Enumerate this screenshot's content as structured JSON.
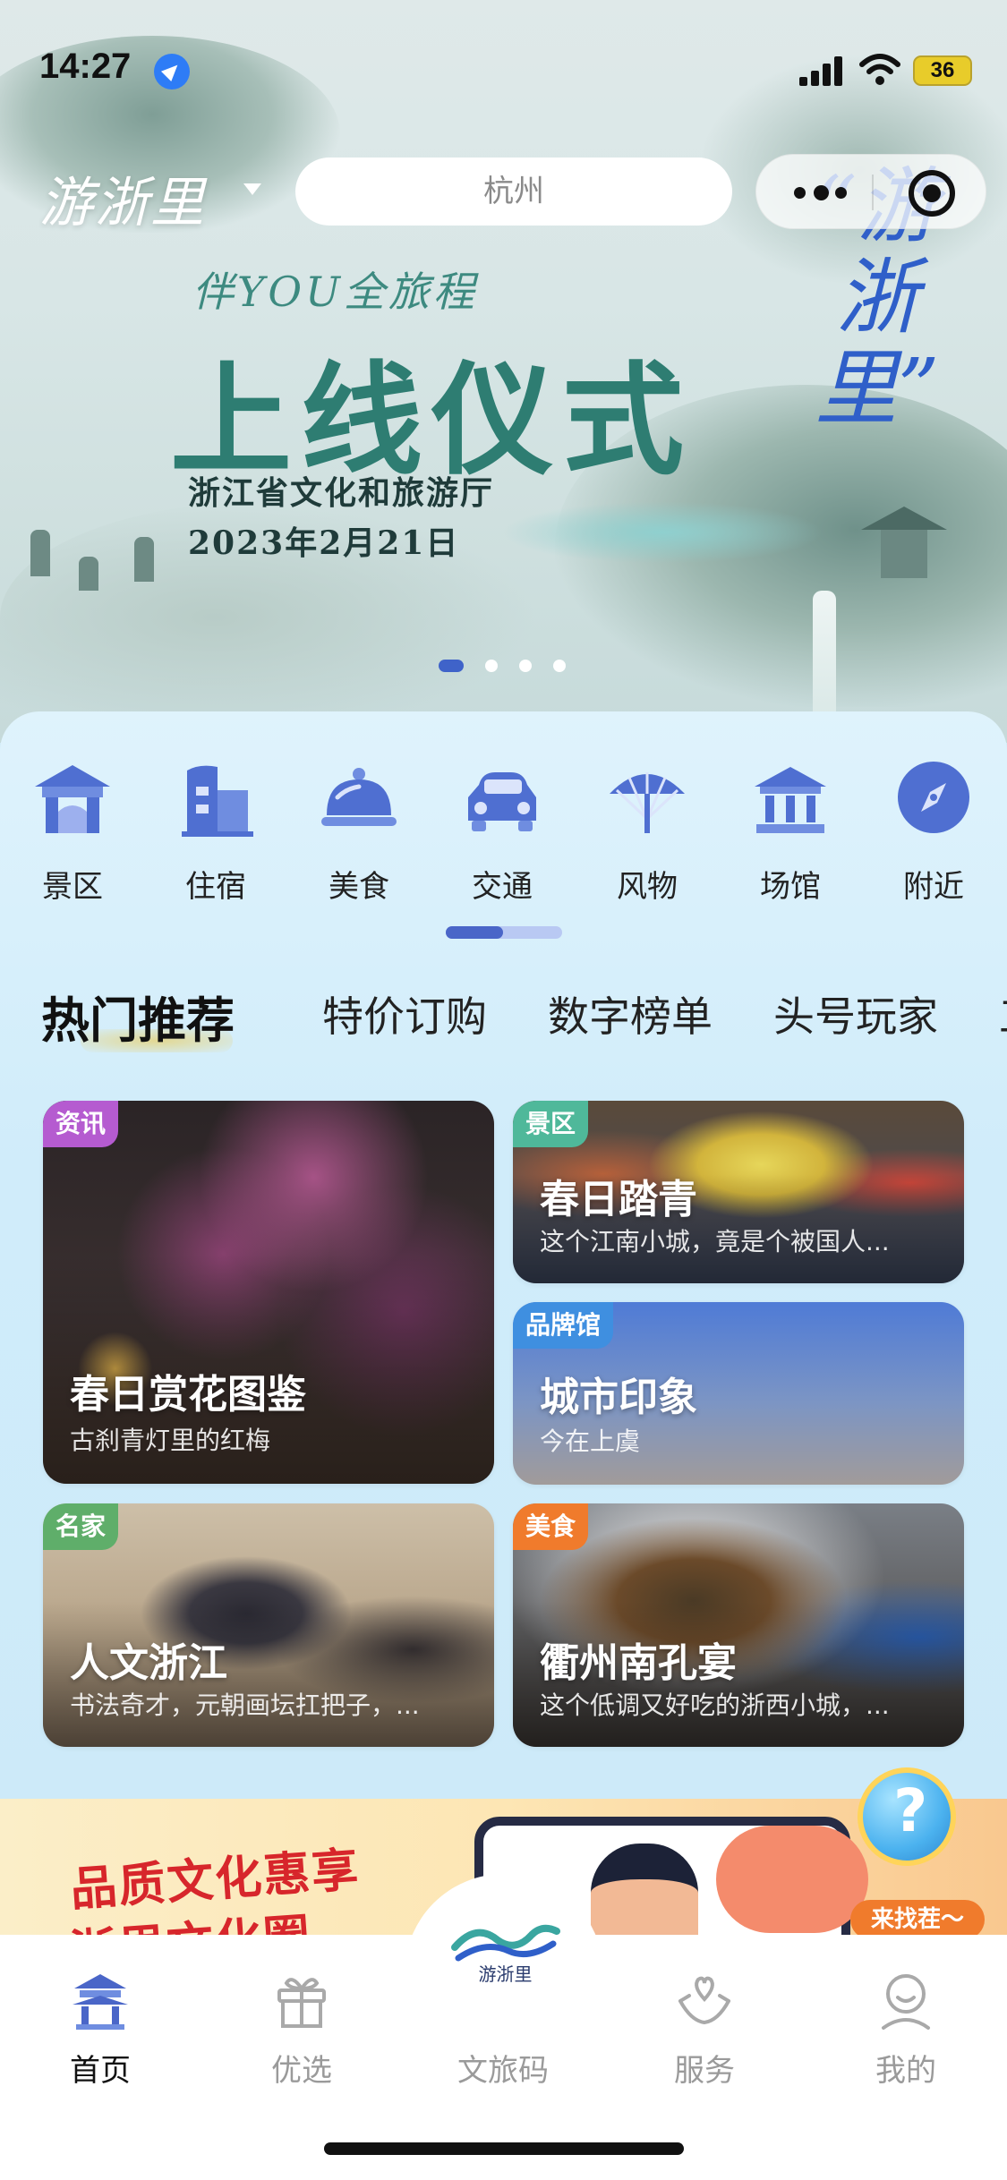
{
  "status_bar": {
    "time": "14:27",
    "battery": "36"
  },
  "header": {
    "brand": "游浙里",
    "search_value": "杭州"
  },
  "banner": {
    "slogan": "伴YOU全旅程",
    "title": "上线仪式",
    "org": "浙江省文化和旅游厅",
    "date": "2023年2月21日",
    "side_text": "“游浙里”",
    "dots": 4,
    "active_dot": 0
  },
  "categories": [
    {
      "label": "景区",
      "icon": "scenic-gate-icon"
    },
    {
      "label": "住宿",
      "icon": "hotel-building-icon"
    },
    {
      "label": "美食",
      "icon": "food-cloche-icon"
    },
    {
      "label": "交通",
      "icon": "car-icon"
    },
    {
      "label": "风物",
      "icon": "fan-icon"
    },
    {
      "label": "场馆",
      "icon": "museum-icon"
    },
    {
      "label": "附近",
      "icon": "compass-icon"
    }
  ],
  "tabs": [
    "热门推荐",
    "特价订购",
    "数字榜单",
    "头号玩家",
    "工"
  ],
  "cards": [
    {
      "badge": "资讯",
      "badge_color": "#b55bd0",
      "title": "春日赏花图鉴",
      "subtitle": "古刹青灯里的红梅"
    },
    {
      "badge": "景区",
      "badge_color": "#4fb89a",
      "title": "春日踏青",
      "subtitle": "这个江南小城，竟是个被国人..."
    },
    {
      "badge": "品牌馆",
      "badge_color": "#3f8fe0",
      "title": "城市印象",
      "subtitle": "今在上虞"
    },
    {
      "badge": "名家",
      "badge_color": "#5fae6a",
      "title": "人文浙江",
      "subtitle": "书法奇才，元朝画坛扛把子，..."
    },
    {
      "badge": "美食",
      "badge_color": "#f07b2c",
      "title": "衢州南孔宴",
      "subtitle": "这个低调又好吃的浙西小城，..."
    }
  ],
  "promo": {
    "line1": "品质文化惠享",
    "line2": "浙里文化圈",
    "help_label": "来找茬～",
    "help_mark": "?"
  },
  "tabbar": [
    {
      "label": "首页",
      "icon": "home-pavilion-icon",
      "active": true
    },
    {
      "label": "优选",
      "icon": "gift-icon",
      "active": false
    },
    {
      "label": "文旅码",
      "icon": "brand-logo-icon",
      "active": false
    },
    {
      "label": "服务",
      "icon": "service-heart-icon",
      "active": false
    },
    {
      "label": "我的",
      "icon": "profile-icon",
      "active": false
    }
  ],
  "center_logo_text": "游浙里",
  "colors": {
    "accent": "#4a66c8",
    "banner_title": "#2e7d72",
    "promo_red": "#d7262b"
  }
}
